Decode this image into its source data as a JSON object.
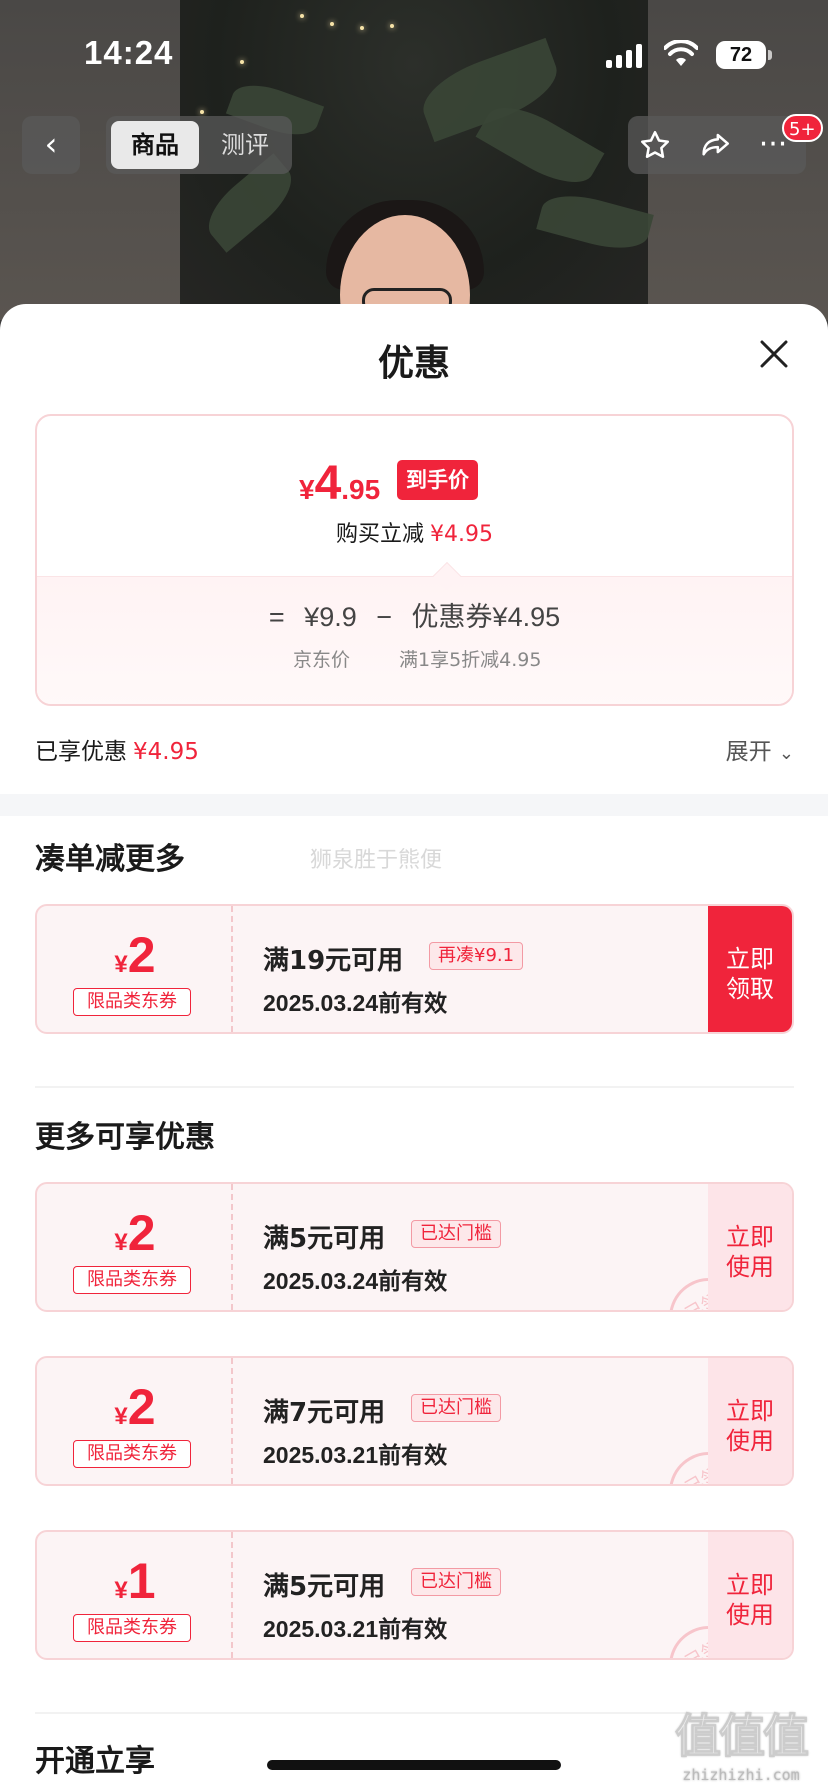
{
  "status_bar": {
    "time": "14:24",
    "battery": "72"
  },
  "nav": {
    "tabs": [
      "商品",
      "测评"
    ],
    "badge": "5+"
  },
  "sheet": {
    "title": "优惠",
    "price": {
      "yen": "¥",
      "int": "4",
      "dec": ".95",
      "tag": "到手价"
    },
    "reduce": {
      "label": "购买立减",
      "value": "¥4.95"
    },
    "formula": {
      "eq": "=",
      "base": "¥9.9",
      "minus": "−",
      "coupon_label": "优惠券",
      "coupon_value": "¥4.95",
      "base_caption": "京东价",
      "coupon_caption": "满1享5折减4.95"
    },
    "savings": {
      "label": "已享优惠",
      "value": "¥4.95",
      "expand": "展开"
    },
    "section1": {
      "title": "凑单减更多",
      "watermark": "狮泉胜于熊便"
    },
    "section2": {
      "title": "更多可享优惠"
    },
    "section3": {
      "title": "开通立享"
    },
    "coupons_more": [
      {
        "yen": "¥",
        "amount": "2",
        "tag": "限品类东券",
        "cond": "满19元可用",
        "chip": "再凑¥9.1",
        "date": "2025.03.24前有效",
        "btn": [
          "立即",
          "领取"
        ]
      }
    ],
    "coupons_available": [
      {
        "yen": "¥",
        "amount": "2",
        "tag": "限品类东券",
        "cond": "满5元可用",
        "chip": "已达门槛",
        "date": "2025.03.24前有效",
        "btn": [
          "立即",
          "使用"
        ],
        "stamp": "已领"
      },
      {
        "yen": "¥",
        "amount": "2",
        "tag": "限品类东券",
        "cond": "满7元可用",
        "chip": "已达门槛",
        "date": "2025.03.21前有效",
        "btn": [
          "立即",
          "使用"
        ],
        "stamp": "已领"
      },
      {
        "yen": "¥",
        "amount": "1",
        "tag": "限品类东券",
        "cond": "满5元可用",
        "chip": "已达门槛",
        "date": "2025.03.21前有效",
        "btn": [
          "立即",
          "使用"
        ],
        "stamp": "已领"
      }
    ]
  },
  "watermark": {
    "logo": "值值值",
    "url": "zhizhizhi.com"
  },
  "colors": {
    "accent": "#f0243b",
    "coupon_bg": "#fcf4f5"
  }
}
